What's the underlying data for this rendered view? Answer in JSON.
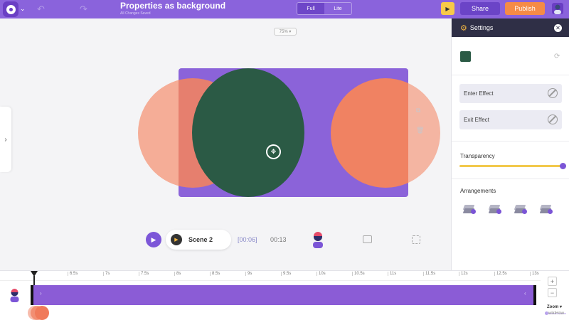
{
  "header": {
    "title": "Properties as background",
    "subtitle": "All Changes Saved",
    "view_toggle": {
      "options": [
        "Full",
        "Lite"
      ],
      "selected": "Full"
    },
    "share_label": "Share",
    "publish_label": "Publish",
    "colors": {
      "bar": "#8a63dc",
      "share": "#6b44c7",
      "publish": "#f58b47"
    }
  },
  "canvas": {
    "zoom_level": "75%",
    "frame_color": "#8b63d9",
    "shapes": [
      {
        "name": "peach-circle",
        "color": "#f4a086"
      },
      {
        "name": "dark-green-circle",
        "color": "#2b5a45"
      },
      {
        "name": "peach-circle",
        "color": "#f4a086"
      }
    ]
  },
  "playback": {
    "scene_label": "Scene 2",
    "current_time": "[00:06]",
    "total_time": "00:13"
  },
  "settings": {
    "title": "Settings",
    "color_swatch": "#2b5a45",
    "enter_effect_label": "Enter Effect",
    "exit_effect_label": "Exit Effect",
    "transparency_label": "Transparency",
    "transparency_value": 1.0,
    "arrangements_label": "Arrangements",
    "arrangement_icons": [
      "bring-forward-icon",
      "send-backward-icon",
      "bring-to-front-icon",
      "send-to-back-icon"
    ]
  },
  "timeline": {
    "ticks": [
      "6.5s",
      "7s",
      "7.5s",
      "8s",
      "8.5s",
      "9s",
      "9.5s",
      "10s",
      "10.5s",
      "11s",
      "11.5s",
      "12s",
      "12.5s",
      "13s"
    ],
    "zoom_label": "Zoom",
    "zoom_in": "+",
    "zoom_out": "−",
    "track_color": "#8b5cd6"
  },
  "watermark": "wikiHow"
}
